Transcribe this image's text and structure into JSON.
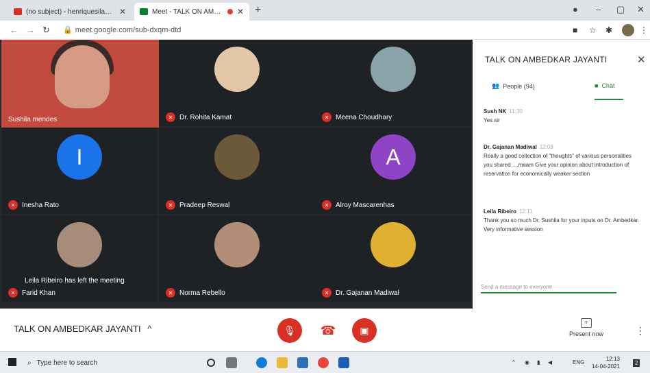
{
  "browser": {
    "tabs": [
      {
        "title": "(no subject) - henriquesila@gmai",
        "favicon_color": "#d93025"
      },
      {
        "title": "Meet - TALK ON AMBEDKA",
        "favicon_color": "#00832d"
      }
    ],
    "new_tab": "+",
    "url": "meet.google.com/sub-dxqm-dtd"
  },
  "meeting": {
    "title": "TALK ON AMBEDKAR JAYANTI",
    "toast": "Leila Ribeiro has left the meeting",
    "participants": [
      {
        "name": "Sushila mendes",
        "avatar": "video",
        "color": "#c34a3f"
      },
      {
        "name": "Dr. Rohita Kamat",
        "avatar": "photo",
        "color": "#e2c6a8"
      },
      {
        "name": "Meena Choudhary",
        "avatar": "photo",
        "color": "#8aa3a8"
      },
      {
        "name": "Inesha Rato",
        "avatar": "I",
        "color": "#1a73e8"
      },
      {
        "name": "Pradeep Reswal",
        "avatar": "photo",
        "color": "#6b5a3a"
      },
      {
        "name": "Alroy Mascarenhas",
        "avatar": "A",
        "color": "#8e44c4"
      },
      {
        "name": "Farid Khan",
        "avatar": "photo",
        "color": "#a88c7a"
      },
      {
        "name": "Norma Rebello",
        "avatar": "photo",
        "color": "#b28e78"
      },
      {
        "name": "Dr. Gajanan Madiwal",
        "avatar": "photo",
        "color": "#e0b030"
      }
    ],
    "controls": {
      "present_label": "Present now"
    }
  },
  "sidebar": {
    "title": "TALK ON AMBEDKAR JAYANTI",
    "people_label": "People (94)",
    "chat_label": "Chat",
    "messages": [
      {
        "author": "Sush NK",
        "time": "11:30",
        "text": "Yes sir"
      },
      {
        "author": "Dr. Gajanan Madiwal",
        "time": "12:08",
        "text": "Really a good collection of \"thoughts\" of various personalities you shared ....maam Give your opinion about introduction of reservation for economically weaker section"
      },
      {
        "author": "Leila Ribeiro",
        "time": "12:11",
        "text": "Thank you so much Dr. Sushila for your inputs on Dr. Ambedkar. Very informative session"
      }
    ],
    "compose_placeholder": "Send a message to everyone"
  },
  "taskbar": {
    "search_placeholder": "Type here to search",
    "lang": "ENG",
    "time": "12:13",
    "date": "14-04-2021"
  }
}
